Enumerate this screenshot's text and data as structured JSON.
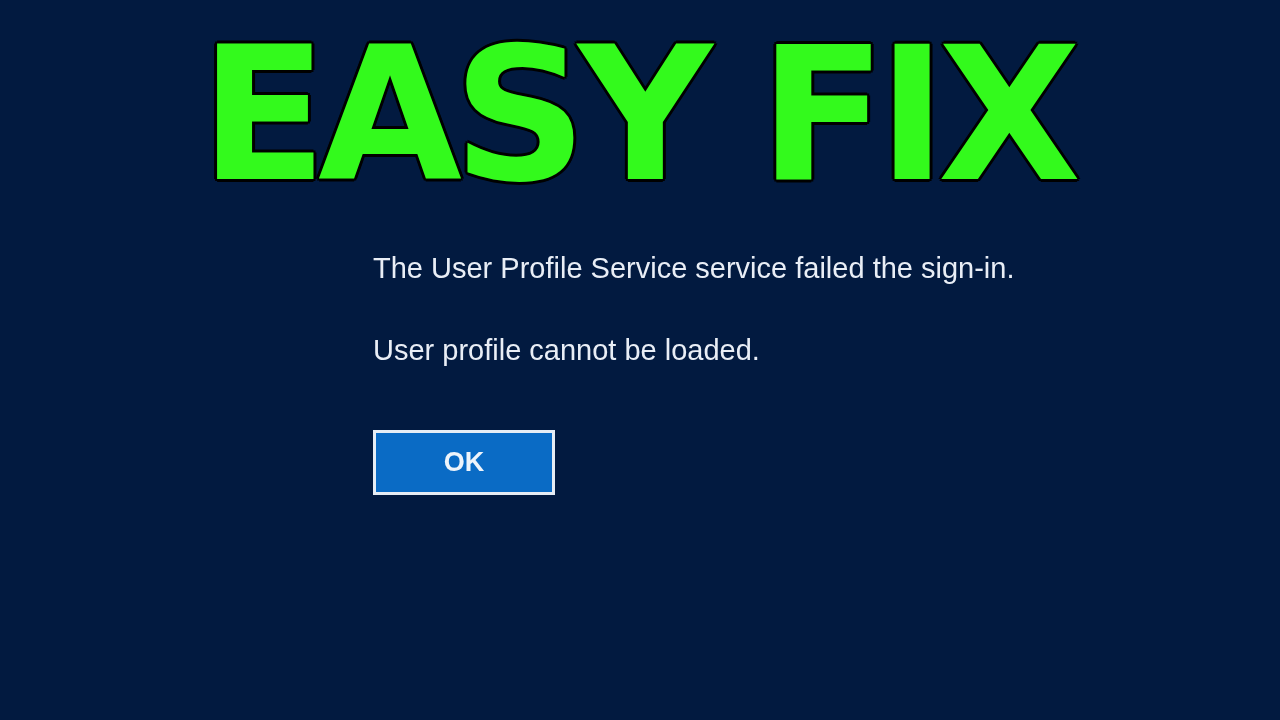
{
  "headline": {
    "text": "EASY FIX"
  },
  "dialog": {
    "messages": [
      "The User Profile Service service failed the sign-in.",
      "User profile cannot be loaded."
    ],
    "button": {
      "label": "OK"
    }
  }
}
